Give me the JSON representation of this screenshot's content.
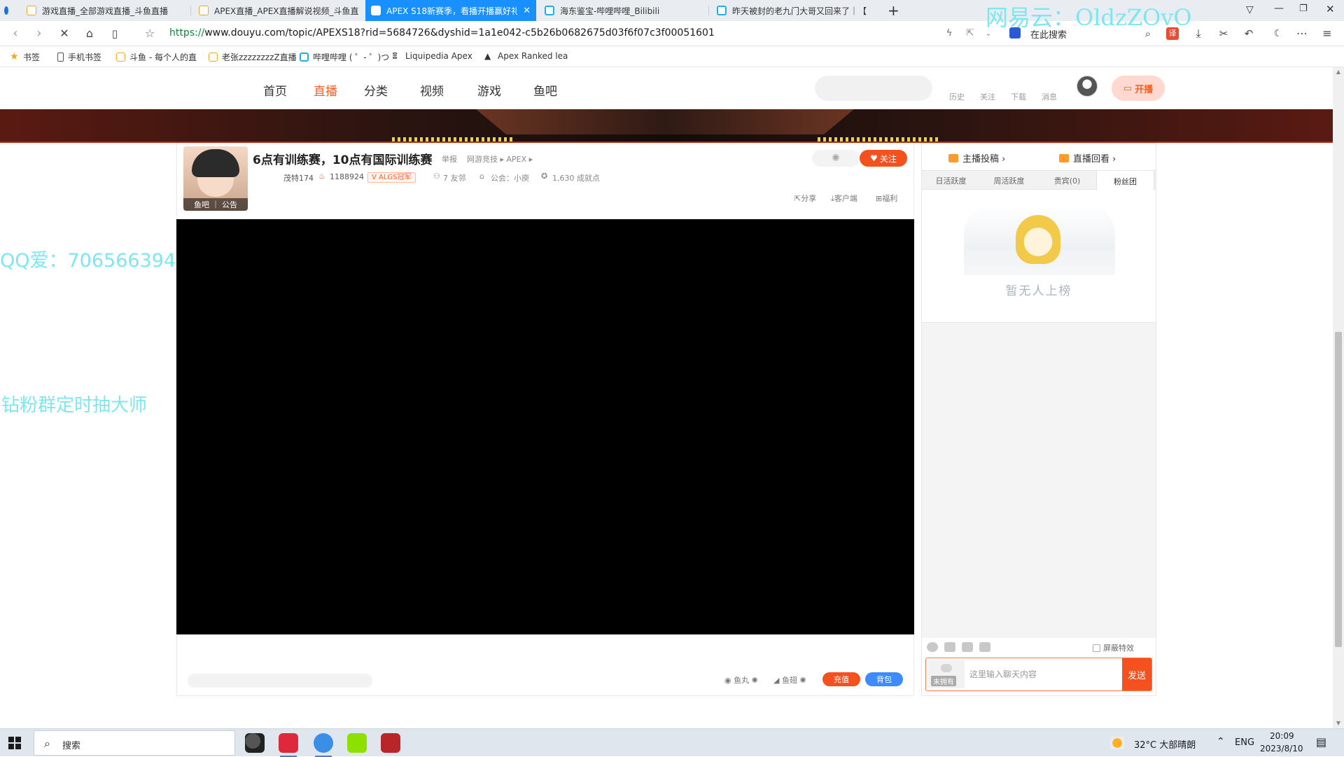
{
  "browser": {
    "tabs": [
      {
        "title": "游戏直播_全部游戏直播_斗鱼直播",
        "active": false
      },
      {
        "title": "APEX直播_APEX直播解说视频_斗鱼直",
        "active": false
      },
      {
        "title": "APEX S18新赛季，看播开播赢好礼",
        "active": true
      },
      {
        "title": "海东鉴宝-哔哩哔哩_Bilibili",
        "active": false
      },
      {
        "title": "昨天被封的老九门大哥又回来了｜【",
        "active": false
      }
    ],
    "new_tab_glyph": "+",
    "url_scheme": "https://",
    "url_rest": "www.douyu.com/topic/APEXS18?rid=5684726&dyshid=1a1e042-c5b26b0682675d03f6f07c3f00051601",
    "search_engine_label": "在此搜索",
    "bookmarks": [
      {
        "label": "书签",
        "icon": "star-icon"
      },
      {
        "label": "手机书签",
        "icon": "phone-icon"
      },
      {
        "label": "斗鱼 - 每个人的直",
        "icon": "douyu-icon"
      },
      {
        "label": "老张zzzzzzzzZ直播",
        "icon": "douyu-icon"
      },
      {
        "label": "哔哩哔哩 ( ゜- ゜)つ",
        "icon": "bilibili-icon"
      },
      {
        "label": "Liquipedia Apex",
        "icon": "liquipedia-icon"
      },
      {
        "label": "Apex Ranked lea",
        "icon": "apex-icon"
      }
    ]
  },
  "site": {
    "nav": [
      "首页",
      "直播",
      "分类",
      "视频",
      "游戏",
      "鱼吧"
    ],
    "active_nav": "直播",
    "header_links": [
      "历史",
      "关注",
      "下载",
      "消息"
    ],
    "start_stream": "开播"
  },
  "room": {
    "title": "6点有训练赛，10点有国际训练赛",
    "report": "举报",
    "category": "网游竞技 ▸ APEX ▸",
    "avatar_bar": "鱼吧 ｜ 公告",
    "streamer_name": "茂特174",
    "hot_value": "1188924",
    "badge": "V  ALGS冠军",
    "friends": "7 友邻",
    "guild": "公会：小庾",
    "achievements": "1,630 成就点",
    "follow": "关注",
    "actions": [
      "分享",
      "客户端",
      "福利"
    ]
  },
  "gifts": {
    "fish_ball": "鱼丸",
    "fish_fin": "鱼翅",
    "recharge": "充值",
    "backpack": "背包"
  },
  "sidebar": {
    "contribution": "主播投稿 ›",
    "replay": "直播回看 ›",
    "rank_tabs": [
      "日活跃度",
      "周活跃度",
      "贵宾(0)",
      "粉丝团"
    ],
    "active_rank_tab": "粉丝团",
    "empty_rank": "暂无人上榜",
    "shield_effects": "屏蔽特效",
    "fan_badge": "未拥有",
    "chat_placeholder": "这里输入聊天内容",
    "send": "发送"
  },
  "overlays": {
    "netease": "网易云：OldzZOvO",
    "qq": "QQ爱：706566394",
    "diamond": "钻粉群定时抽大师"
  },
  "taskbar": {
    "search": "搜索",
    "weather": "32°C  大部晴朗",
    "lang": "ENG",
    "time": "20:09",
    "date": "2023/8/10"
  }
}
